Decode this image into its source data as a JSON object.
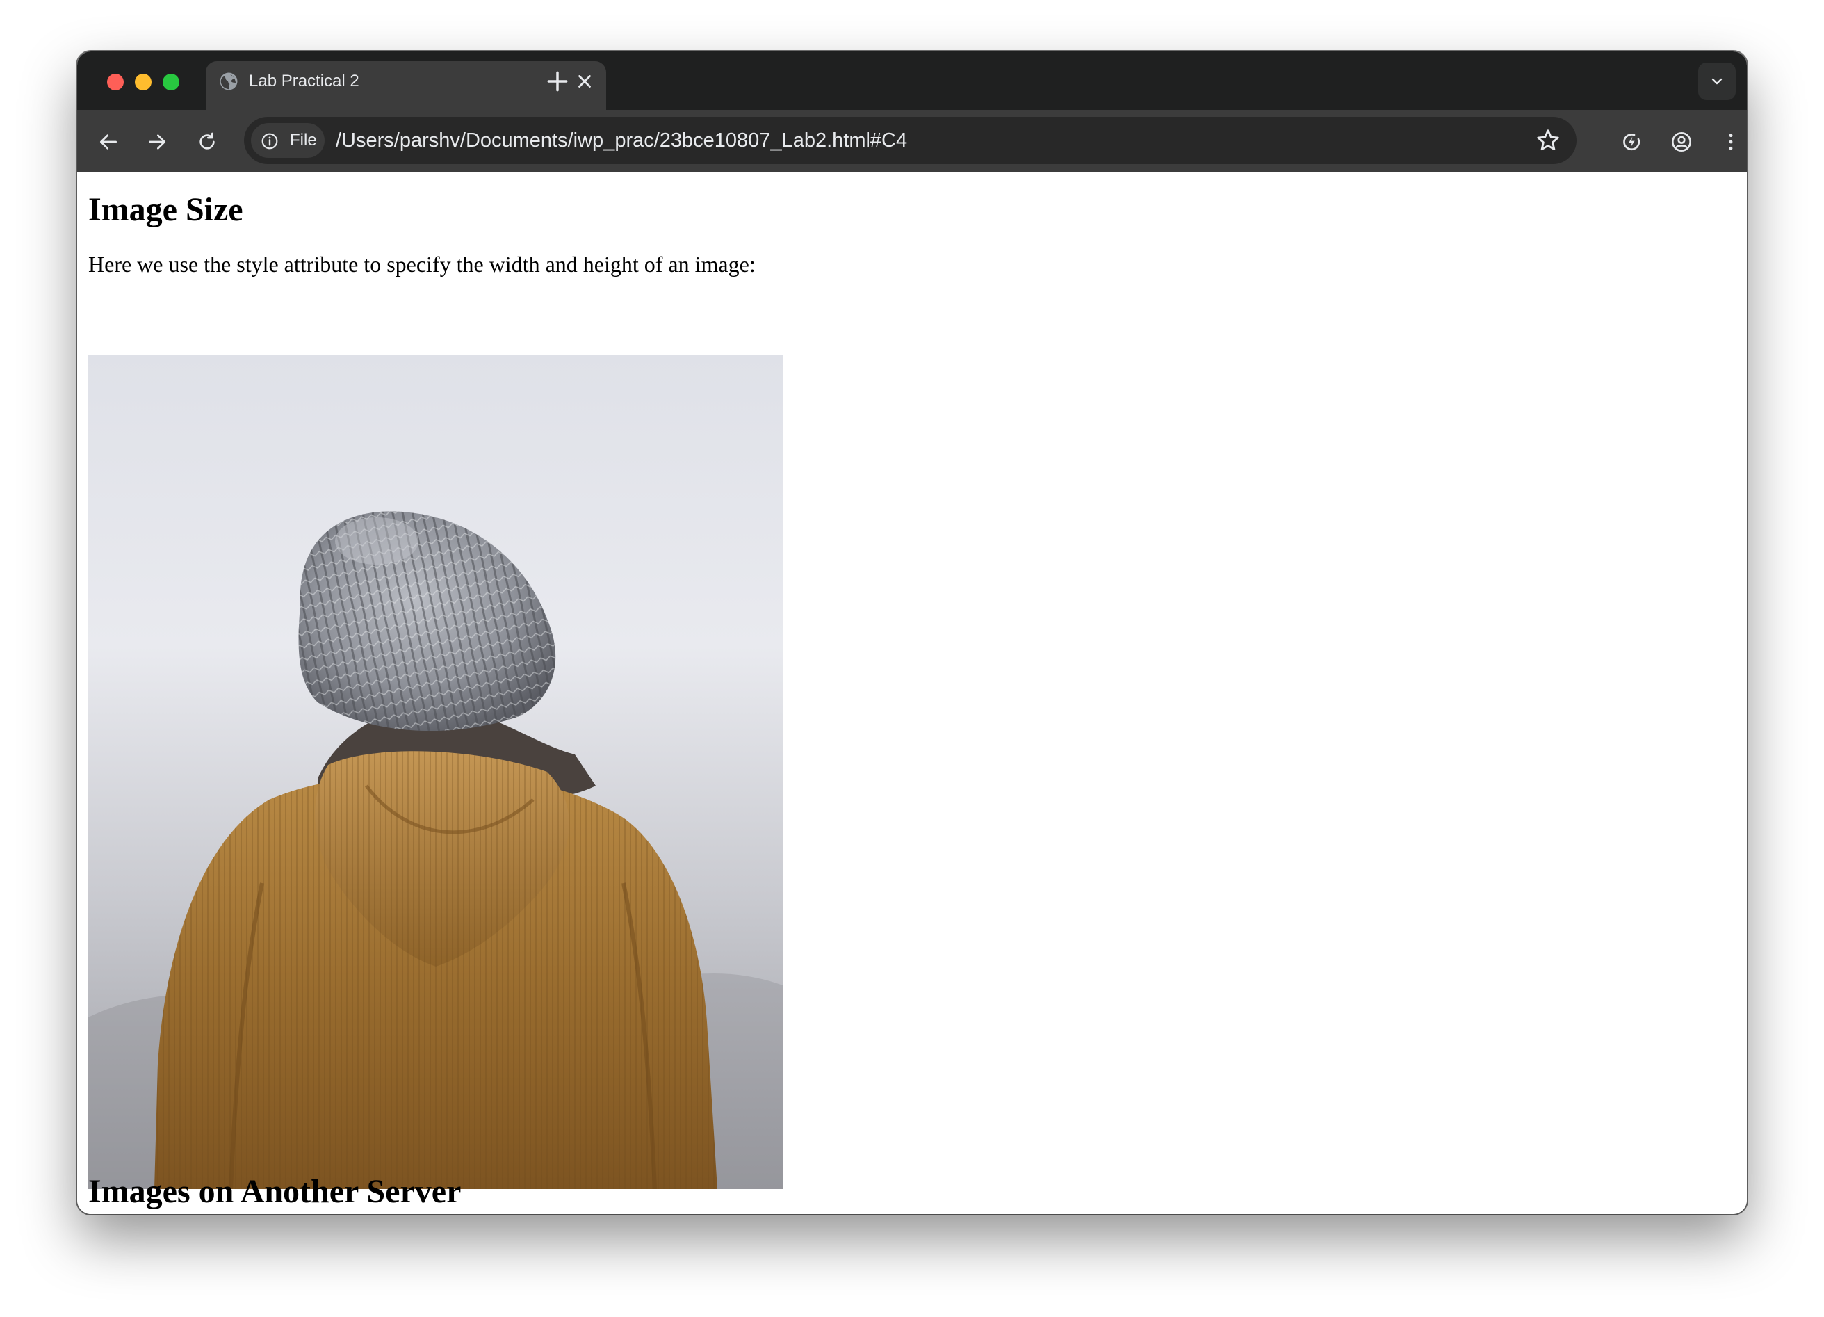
{
  "browser": {
    "tab": {
      "title": "Lab Practical 2",
      "favicon": "globe-icon"
    },
    "toolbar": {
      "security_chip_label": "File",
      "url": "/Users/parshv/Documents/iwp_prac/23bce10807_Lab2.html#C4"
    },
    "icons": {
      "back": "back-arrow-icon",
      "forward": "forward-arrow-icon",
      "reload": "reload-icon",
      "info": "info-icon",
      "bookmark": "star-icon",
      "performance": "lightning-icon",
      "profile": "profile-icon",
      "menu": "kebab-menu-icon",
      "tab_search": "chevron-down-icon",
      "new_tab": "plus-icon",
      "close_tab": "close-icon"
    }
  },
  "page": {
    "heading_image_size": "Image Size",
    "intro_text": "Here we use the style attribute to specify the width and height of an image:",
    "photo_description": "person-in-beanie-and-corduroy-jacket-photo",
    "heading_other_server": "Images on Another Server"
  },
  "colors": {
    "tabstrip_bg": "#1f2020",
    "toolbar_bg": "#3c3c3c",
    "omnibox_bg": "#282828",
    "traffic_red": "#fe5f57",
    "traffic_yellow": "#febc2e",
    "traffic_green": "#28c840"
  }
}
